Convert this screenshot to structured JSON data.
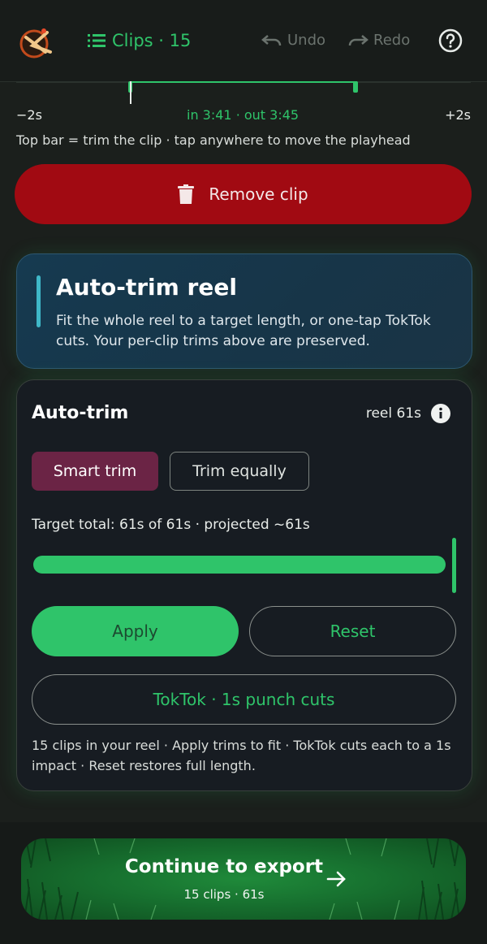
{
  "header": {
    "clips_tab": "Clips · 15",
    "undo_label": "Undo",
    "redo_label": "Redo"
  },
  "timeline": {
    "minus_label": "−2s",
    "inout_label": "in 3:41 · out 3:45",
    "plus_label": "+2s",
    "hint": "Top bar = trim the clip · tap anywhere to move the playhead"
  },
  "remove_clip_label": "Remove clip",
  "info_card": {
    "title": "Auto-trim reel",
    "body": "Fit the whole reel to a target length, or one-tap TokTok cuts. Your per-clip trims above are preserved."
  },
  "auto_trim": {
    "title": "Auto-trim",
    "reel_length": "reel 61s",
    "modes": [
      "Smart trim",
      "Trim equally"
    ],
    "selected_mode": "Smart trim",
    "target_text": "Target total: 61s of 61s  ·  projected ~61s",
    "target_fraction": 1.0,
    "apply_label": "Apply",
    "reset_label": "Reset",
    "toktok_label": "TokTok · 1s punch cuts",
    "footer": "15 clips in your reel · Apply trims to fit · TokTok cuts each to a 1s impact · Reset restores full length."
  },
  "export": {
    "title": "Continue to export",
    "subtitle": "15 clips · 61s"
  },
  "colors": {
    "accent_green": "#2fc46a",
    "danger_red": "#a10a12",
    "selected_mode": "#6b2445"
  }
}
